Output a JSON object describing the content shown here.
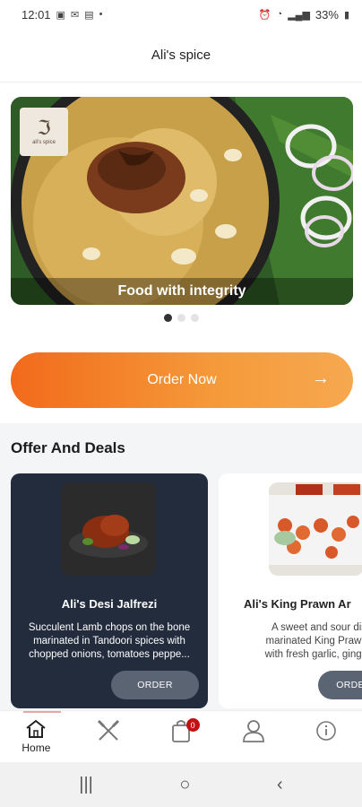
{
  "status_bar": {
    "time": "12:01",
    "battery": "33%"
  },
  "header": {
    "title": "Ali's spice"
  },
  "banner": {
    "logo_text": "ali's spice",
    "caption": "Food with integrity",
    "slides": 3,
    "active_slide": 1
  },
  "cta": {
    "order_now_label": "Order Now"
  },
  "offers": {
    "title": "Offer And Deals",
    "items": [
      {
        "name": "Ali's Desi Jalfrezi",
        "description_line1": "Succulent Lamb chops on the bone",
        "description_line2": "marinated in Tandoori spices with",
        "description_line3": "chopped onions, tomatoes peppe...",
        "button": "ORDER"
      },
      {
        "name": "Ali's King Prawn Ar",
        "description_line1": "A sweet and sour dis",
        "description_line2": "marinated King Prawns",
        "description_line3": "with fresh garlic, ginger,",
        "button": "ORDER"
      }
    ]
  },
  "bottom_nav": {
    "home_label": "Home",
    "cart_count": "0"
  },
  "colors": {
    "accent_orange": "#f26a1b",
    "deal_dark": "#222c3d",
    "badge_red": "#c11111"
  }
}
